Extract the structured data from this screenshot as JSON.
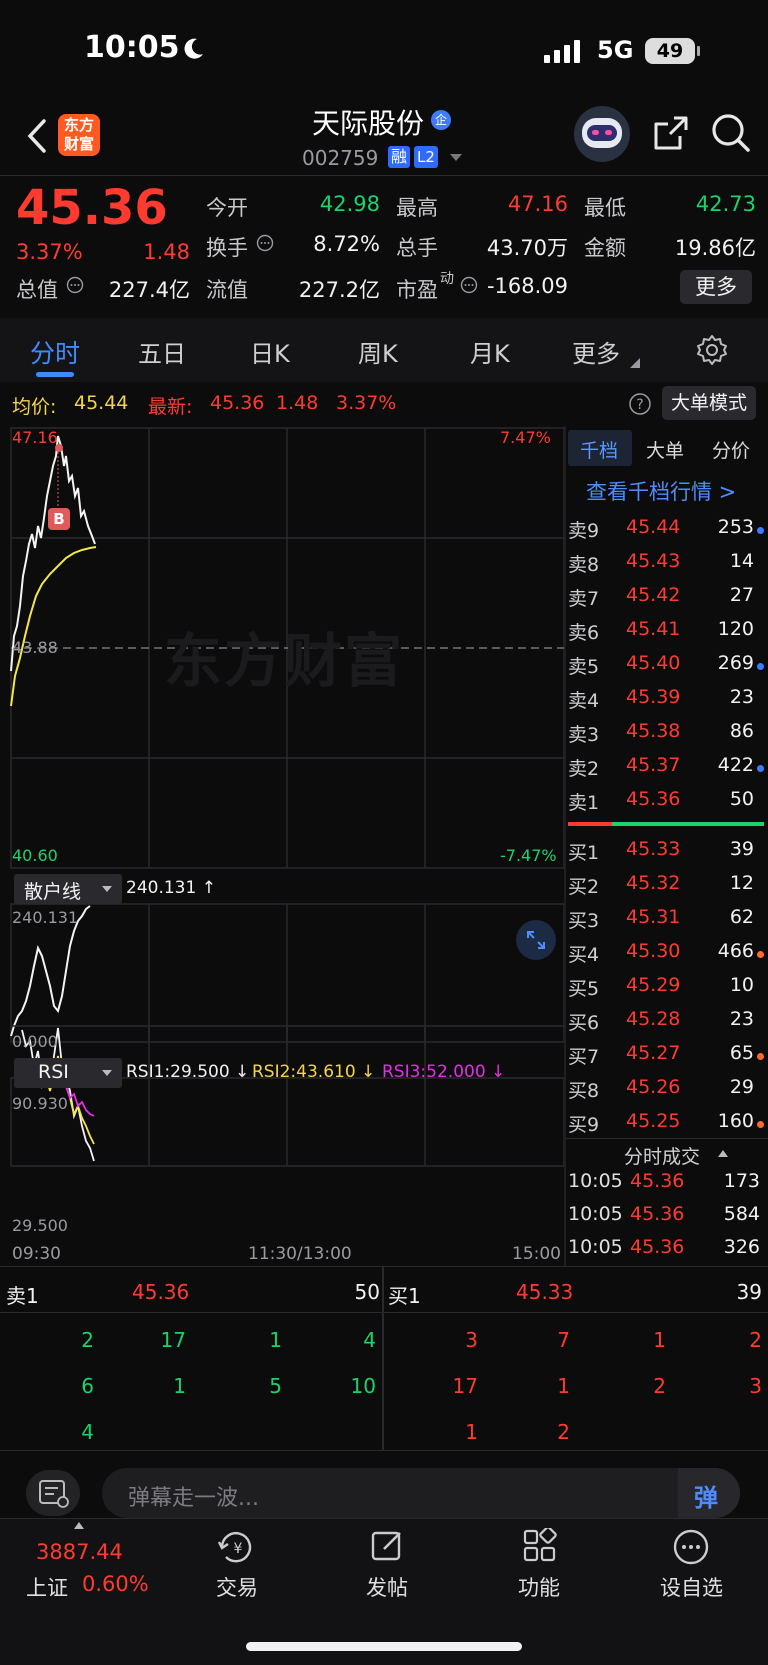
{
  "status_bar": {
    "time": "10:05",
    "network": "5G",
    "battery": "49"
  },
  "header": {
    "logo_text": "东方财富",
    "stock_name": "天际股份",
    "badge_qi": "企",
    "stock_code": "002759",
    "badge_rong": "融",
    "badge_l2": "L2"
  },
  "quote": {
    "price": "45.36",
    "change_pct": "3.37%",
    "change": "1.48",
    "items": [
      {
        "label": "今开",
        "value": "42.98",
        "color": "green"
      },
      {
        "label": "最高",
        "value": "47.16",
        "color": "red"
      },
      {
        "label": "最低",
        "value": "42.73",
        "color": "green"
      },
      {
        "label": "换手",
        "value": "8.72%",
        "color": "white"
      },
      {
        "label": "总手",
        "value": "43.70万",
        "color": "white"
      },
      {
        "label": "金额",
        "value": "19.86亿",
        "color": "white"
      },
      {
        "label": "总值",
        "value": "227.4亿",
        "color": "white"
      },
      {
        "label": "流值",
        "value": "227.2亿",
        "color": "white"
      },
      {
        "label": "市盈",
        "value": "-168.09",
        "color": "white"
      }
    ],
    "pe_sup": "动",
    "more_button": "更多"
  },
  "tabs": [
    "分时",
    "五日",
    "日K",
    "周K",
    "月K",
    "更多"
  ],
  "intraday": {
    "avg_label": "均价:",
    "avg_value": "45.44",
    "latest_label": "最新:",
    "latest_value": "45.36",
    "latest_change": "1.48",
    "latest_pct": "3.37%",
    "big_order_mode": "大单模式",
    "price_high": "47.16",
    "price_mid": "43.88",
    "price_low": "40.60",
    "pct_high": "7.47%",
    "pct_low": "-7.47%",
    "buy_marker": "B",
    "watermark": "东方财富",
    "retail_indicator": "散户线",
    "retail_value": "240.131 ↑",
    "retail_max": "240.131",
    "retail_min": "0.000",
    "rsi_indicator": "RSI",
    "rsi1": "RSI1:29.500 ↓",
    "rsi2": "RSI2:43.610 ↓",
    "rsi3": "RSI3:52.000 ↓",
    "rsi_max": "90.930",
    "rsi_min": "29.500",
    "time_start": "09:30",
    "time_mid": "11:30/13:00",
    "time_end": "15:00"
  },
  "orderbook": {
    "tabs": [
      "千档",
      "大单",
      "分价"
    ],
    "view_link": "查看千档行情 >",
    "asks": [
      {
        "label": "卖9",
        "price": "45.44",
        "vol": "253",
        "dot": "#3d7bff"
      },
      {
        "label": "卖8",
        "price": "45.43",
        "vol": "14",
        "dot": ""
      },
      {
        "label": "卖7",
        "price": "45.42",
        "vol": "27",
        "dot": ""
      },
      {
        "label": "卖6",
        "price": "45.41",
        "vol": "120",
        "dot": ""
      },
      {
        "label": "卖5",
        "price": "45.40",
        "vol": "269",
        "dot": "#3d7bff"
      },
      {
        "label": "卖4",
        "price": "45.39",
        "vol": "23",
        "dot": ""
      },
      {
        "label": "卖3",
        "price": "45.38",
        "vol": "86",
        "dot": ""
      },
      {
        "label": "卖2",
        "price": "45.37",
        "vol": "422",
        "dot": "#3d7bff"
      },
      {
        "label": "卖1",
        "price": "45.36",
        "vol": "50",
        "dot": ""
      }
    ],
    "bids": [
      {
        "label": "买1",
        "price": "45.33",
        "vol": "39",
        "dot": ""
      },
      {
        "label": "买2",
        "price": "45.32",
        "vol": "12",
        "dot": ""
      },
      {
        "label": "买3",
        "price": "45.31",
        "vol": "62",
        "dot": ""
      },
      {
        "label": "买4",
        "price": "45.30",
        "vol": "466",
        "dot": "#ff6a2b"
      },
      {
        "label": "买5",
        "price": "45.29",
        "vol": "10",
        "dot": ""
      },
      {
        "label": "买6",
        "price": "45.28",
        "vol": "23",
        "dot": ""
      },
      {
        "label": "买7",
        "price": "45.27",
        "vol": "65",
        "dot": "#ff6a2b"
      },
      {
        "label": "买8",
        "price": "45.26",
        "vol": "29",
        "dot": ""
      },
      {
        "label": "买9",
        "price": "45.25",
        "vol": "160",
        "dot": "#ff6a2b"
      }
    ],
    "trades_title": "分时成交",
    "trades": [
      {
        "time": "10:05",
        "price": "45.36",
        "vol": "173",
        "color": "green"
      },
      {
        "time": "10:05",
        "price": "45.36",
        "vol": "584",
        "color": "green"
      },
      {
        "time": "10:05",
        "price": "45.36",
        "vol": "326",
        "color": "red"
      }
    ]
  },
  "queue": {
    "sell_label": "卖1",
    "sell_price": "45.36",
    "sell_vol": "50",
    "buy_label": "买1",
    "buy_price": "45.33",
    "buy_vol": "39",
    "sell_queue": [
      "2",
      "17",
      "1",
      "4",
      "6",
      "1",
      "5",
      "10",
      "4"
    ],
    "buy_queue": [
      "3",
      "7",
      "1",
      "2",
      "17",
      "1",
      "2",
      "3",
      "1",
      "2"
    ]
  },
  "comment": {
    "placeholder": "弹幕走一波...",
    "send": "弹"
  },
  "bottom_nav": {
    "index_value": "3887.44",
    "index_name": "上证",
    "index_pct": "0.60%",
    "items": [
      "交易",
      "发帖",
      "功能",
      "设自选"
    ]
  }
}
